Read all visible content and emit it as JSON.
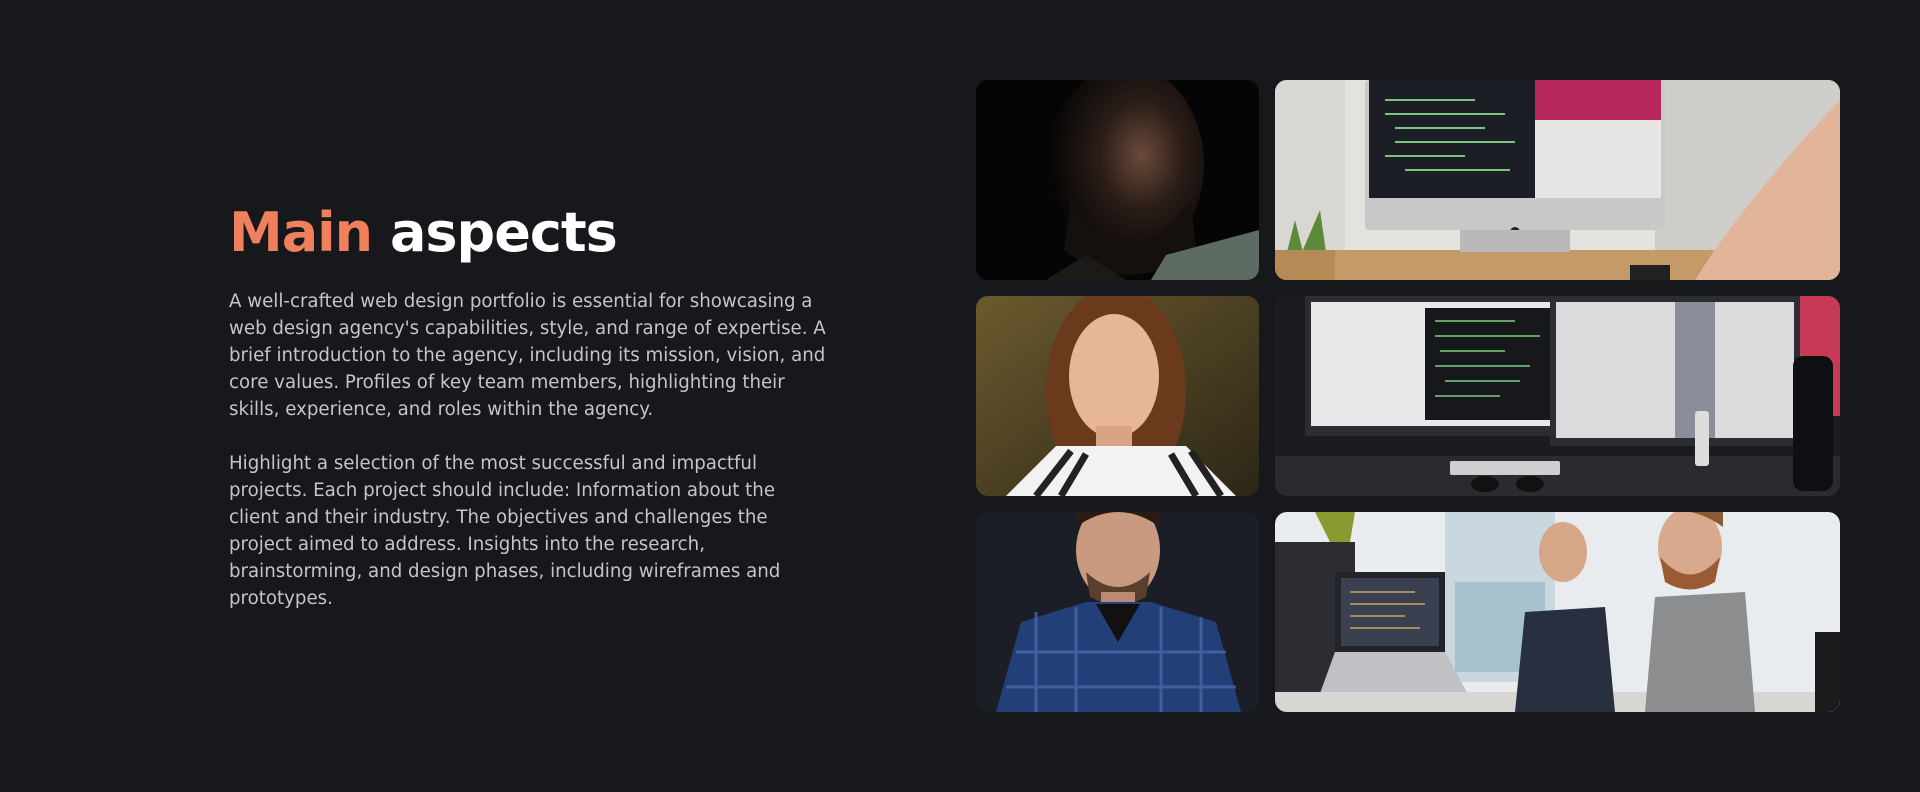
{
  "section": {
    "title_accent": "Main",
    "title_rest": "aspects",
    "paragraphs": [
      "A well-crafted web design portfolio is essential for showcasing a web design agency's capabilities, style, and range of expertise. A brief introduction to the agency, including its mission, vision, and core values. Profiles of key team members, highlighting their skills, experience, and roles within the agency.",
      "Highlight a selection of the most successful and impactful projects. Each project should include: Information about the client and their industry. The objectives and challenges the project aimed to address. Insights into the research, brainstorming, and design phases, including wireframes and prototypes."
    ]
  },
  "colors": {
    "background": "#17181c",
    "accent": "#f07f5c",
    "heading": "#ffffff",
    "body_text": "#c4c5cb"
  }
}
